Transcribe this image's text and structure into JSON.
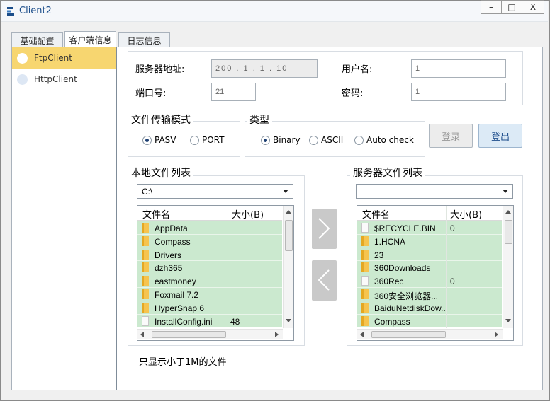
{
  "window": {
    "title": "Client2",
    "controls": {
      "minimize": "–",
      "maximize": "□",
      "close": "X"
    }
  },
  "tabs": [
    {
      "label": "基础配置"
    },
    {
      "label": "客户端信息"
    },
    {
      "label": "日志信息"
    }
  ],
  "sidebar": {
    "items": [
      {
        "label": "FtpClient"
      },
      {
        "label": "HttpClient"
      }
    ]
  },
  "connection": {
    "server_address_label": "服务器地址:",
    "server_address_value": "200 . 1 . 1 . 10",
    "port_label": "端口号:",
    "port_value": "21",
    "username_label": "用户名:",
    "username_value": "1",
    "password_label": "密码:",
    "password_value": "1"
  },
  "transfer_mode": {
    "title": "文件传输模式",
    "options": [
      {
        "label": "PASV",
        "selected": true
      },
      {
        "label": "PORT",
        "selected": false
      }
    ]
  },
  "type": {
    "title": "类型",
    "options": [
      {
        "label": "Binary",
        "selected": true
      },
      {
        "label": "ASCII",
        "selected": false
      },
      {
        "label": "Auto check",
        "selected": false
      }
    ]
  },
  "actions": {
    "login_label": "登录",
    "logout_label": "登出"
  },
  "local_files": {
    "title": "本地文件列表",
    "drive": "C:\\",
    "columns": {
      "name": "文件名",
      "size": "大小(B)"
    },
    "rows": [
      {
        "name": "AppData",
        "size": "",
        "icon": "folder"
      },
      {
        "name": "Compass",
        "size": "",
        "icon": "folder"
      },
      {
        "name": "Drivers",
        "size": "",
        "icon": "folder"
      },
      {
        "name": "dzh365",
        "size": "",
        "icon": "folder"
      },
      {
        "name": "eastmoney",
        "size": "",
        "icon": "folder"
      },
      {
        "name": "Foxmail 7.2",
        "size": "",
        "icon": "folder"
      },
      {
        "name": "HyperSnap 6",
        "size": "",
        "icon": "folder"
      },
      {
        "name": "InstallConfig.ini",
        "size": "48",
        "icon": "file"
      }
    ]
  },
  "server_files": {
    "title": "服务器文件列表",
    "drive": "",
    "columns": {
      "name": "文件名",
      "size": "大小(B)"
    },
    "rows": [
      {
        "name": "$RECYCLE.BIN",
        "size": "0",
        "icon": "file"
      },
      {
        "name": "1.HCNA",
        "size": "",
        "icon": "folder"
      },
      {
        "name": "23",
        "size": "",
        "icon": "folder"
      },
      {
        "name": "360Downloads",
        "size": "",
        "icon": "folder"
      },
      {
        "name": "360Rec",
        "size": "0",
        "icon": "file"
      },
      {
        "name": "360安全浏览器...",
        "size": "",
        "icon": "folder"
      },
      {
        "name": "BaiduNetdiskDow...",
        "size": "",
        "icon": "folder"
      },
      {
        "name": "Compass",
        "size": "",
        "icon": "folder"
      }
    ]
  },
  "note": "只显示小于1M的文件",
  "colors": {
    "accent": "#f7d670",
    "row": "#cbe9cf",
    "primary_button": "#dceaf6"
  }
}
